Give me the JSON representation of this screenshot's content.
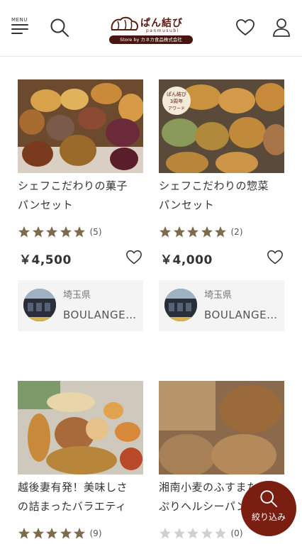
{
  "header": {
    "menu_label": "MENU",
    "logo_jp": "ぱん結び",
    "logo_roman": "panmusubi",
    "logo_store": "Store by カネカ食品株式会社"
  },
  "products": [
    {
      "title_line1": "シェフこだわりの菓子",
      "title_line2": "パンセット",
      "rating": 5,
      "review_count": "(5)",
      "price": "￥4,500",
      "shop_pref": "埼玉県",
      "shop_name": "BOULANGERIE"
    },
    {
      "title_line1": "シェフこだわりの惣菜",
      "title_line2": "パンセット",
      "badge_line1": "ぱん結び",
      "badge_line2": "3周年",
      "badge_line3": "アワード",
      "rating": 5,
      "review_count": "(2)",
      "price": "￥4,000",
      "shop_pref": "埼玉県",
      "shop_name": "BOULANGERIE"
    },
    {
      "title_line1": "越後妻有発！美味しさ",
      "title_line2": "の詰まったバラエティ",
      "rating": 5,
      "review_count": "(9)"
    },
    {
      "title_line1": "湘南小麦のふすまたっ",
      "title_line2": "ぷりヘルシーパン",
      "rating": 0,
      "review_count": "(0)"
    }
  ],
  "filter": {
    "label": "絞り込み"
  },
  "colors": {
    "brand": "#7a1e12",
    "star_on": "#7d6b4e",
    "star_off": "#d0d0d0"
  }
}
